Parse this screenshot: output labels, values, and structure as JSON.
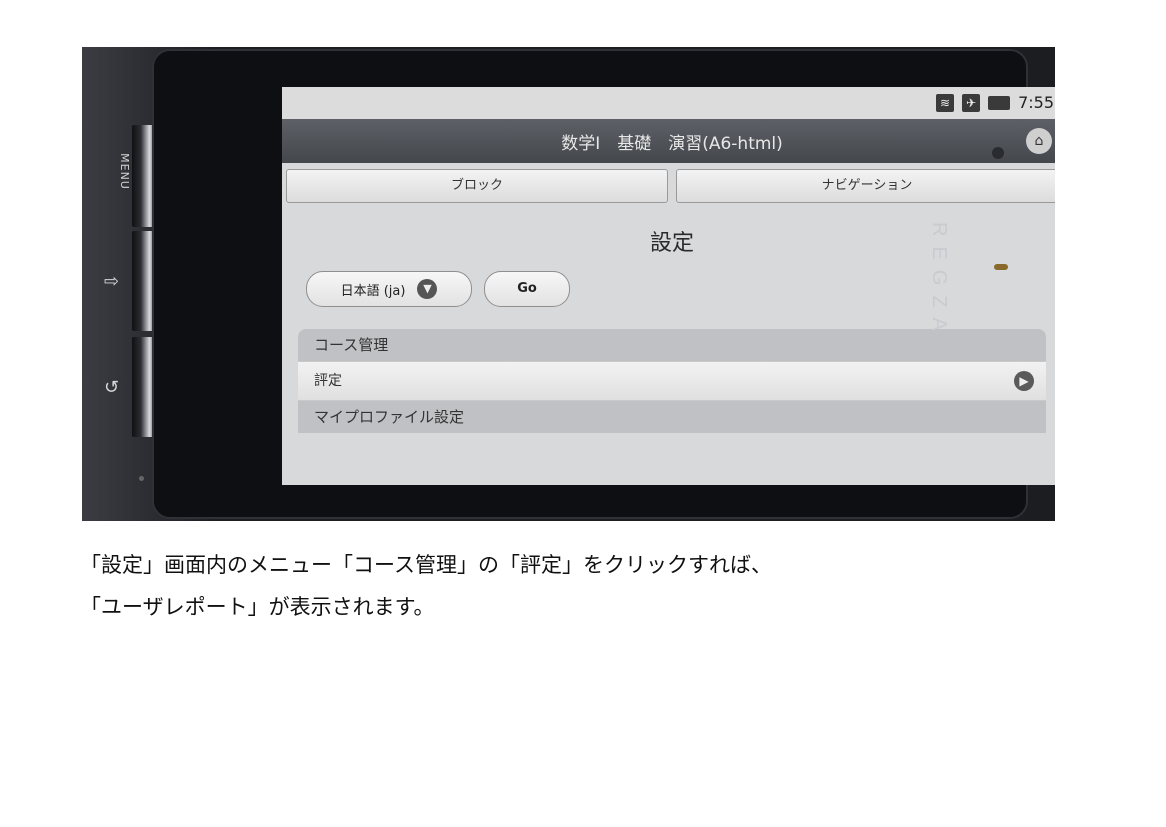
{
  "status_bar": {
    "time": "7:55",
    "icons": [
      "wifi-icon",
      "airplane-icon",
      "battery-icon"
    ]
  },
  "header": {
    "title": "数学Ⅰ　基礎　演習(A6-html)"
  },
  "tabs": [
    {
      "label": "ブロック"
    },
    {
      "label": "ナビゲーション"
    }
  ],
  "page": {
    "title": "設定"
  },
  "controls": {
    "language": "日本語 (ja)",
    "go_label": "Go"
  },
  "menu": {
    "section1": "コース管理",
    "item1": "評定",
    "section2": "マイプロファイル設定"
  },
  "device": {
    "brand": "REGZA",
    "menu_label": "MENU"
  },
  "caption": {
    "line1": "「設定」画面内のメニュー「コース管理」の「評定」をクリックすれば、",
    "line2": "「ユーザレポート」が表示されます。"
  }
}
